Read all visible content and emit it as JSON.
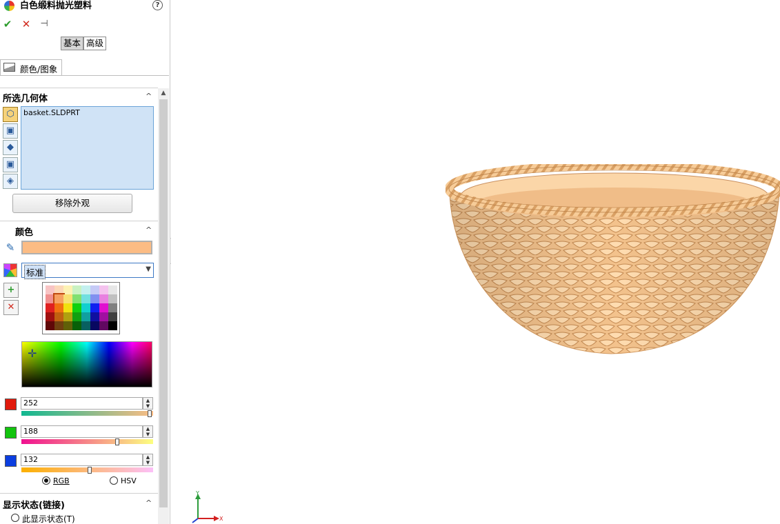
{
  "panel": {
    "title": "白色缎料抛光塑料",
    "help": "?",
    "toolbar": {
      "ok": "✔",
      "cancel": "✕",
      "pin": "⊣"
    },
    "modes": {
      "basic": "基本",
      "advanced": "高级"
    },
    "tab": {
      "label": "颜色/图象"
    },
    "geometry": {
      "header": "所选几何体",
      "caret": "^",
      "items": [
        "basket.SLDPRT"
      ],
      "remove_button": "移除外观"
    },
    "color": {
      "header": "颜色",
      "caret": "^",
      "current_color": "#fcbc84",
      "palette_combo": "标准",
      "red": {
        "value": "252",
        "level": 252
      },
      "green": {
        "value": "188",
        "level": 188
      },
      "blue": {
        "value": "132",
        "level": 132
      },
      "mode_rgb": "RGB",
      "mode_hsv": "HSV",
      "selected_mode": "RGB",
      "red_swatch": "#e11a0c",
      "green_swatch": "#12c40e",
      "blue_swatch": "#0b3ee0"
    },
    "display_state": {
      "header": "显示状态(链接)",
      "caret": "^",
      "option": "此显示状态(T)"
    }
  },
  "viewport": {
    "axis_y": "Y",
    "axis_x": "X",
    "model_color": "#f6c894"
  }
}
